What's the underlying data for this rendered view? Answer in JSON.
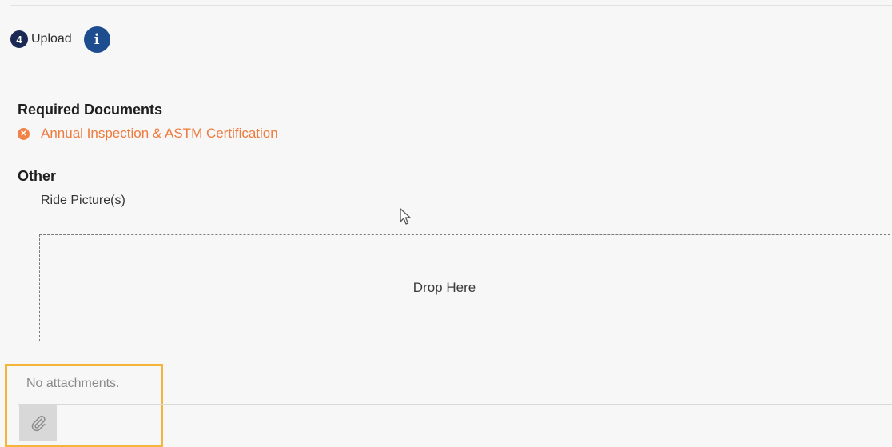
{
  "step": {
    "number": "4",
    "title": "Upload",
    "info_icon": "info-icon"
  },
  "required_documents": {
    "heading": "Required Documents",
    "items": [
      {
        "label": "Annual Inspection & ASTM Certification",
        "status_icon": "error-circle-icon"
      }
    ]
  },
  "other": {
    "heading": "Other",
    "items": [
      {
        "label": "Ride Picture(s)"
      }
    ]
  },
  "drop_zone": {
    "text": "Drop Here"
  },
  "attachments": {
    "empty_text": "No attachments.",
    "attach_icon": "paperclip-icon"
  },
  "colors": {
    "step_badge": "#1a2a55",
    "info_icon": "#1d4d8f",
    "required_error": "#ee7a3c",
    "highlight_box": "#f5b53a"
  }
}
